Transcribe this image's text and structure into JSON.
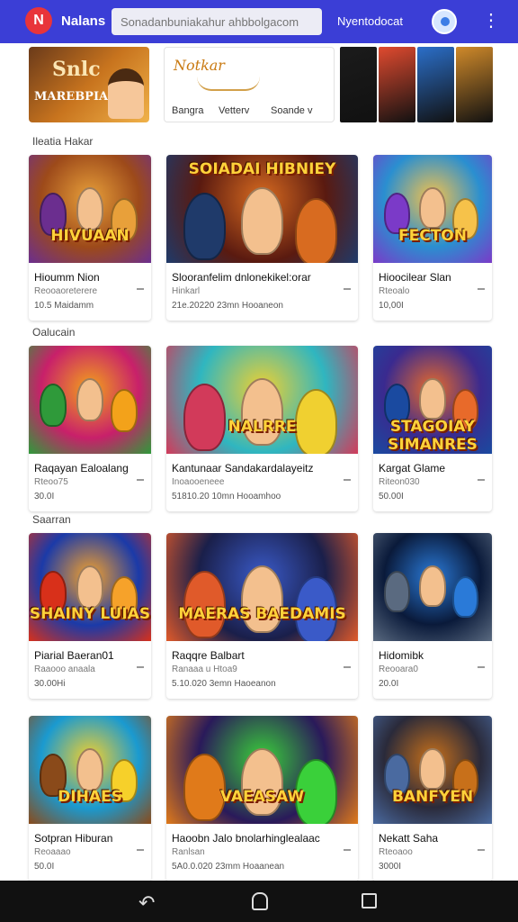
{
  "header": {
    "logo_letter": "N",
    "app_name": "Nalans",
    "search_placeholder": "Sonadanbuniakahur ahbbolgacom",
    "link": "Nyentodocat"
  },
  "banners": {
    "a_title": "Snlc",
    "a_subtitle": "MAREBPIAEE",
    "b_title": "Notkar",
    "b_filters": [
      "Bangra",
      "Vetterv",
      "Soande v"
    ],
    "c_colors": [
      "#1b1b1b",
      "#e04a2f",
      "#2b6fc9",
      "#d08a2a"
    ]
  },
  "sections": [
    {
      "label": "Ileatia Hakar",
      "cards": [
        {
          "name": "Hioumm Nion",
          "meta": "Reooaoreterere",
          "price": "10.5 Maidamm",
          "art": "HIVUAAN",
          "colors": [
            "#9d4a1a",
            "#e8a03a",
            "#6b2e8f"
          ]
        },
        {
          "name": "Slooranfelim dnlonekikel:orar",
          "meta": "Hinkarl",
          "price": "21e.20220   23mn   Hooaneon",
          "art": "SOIADAI HIBNIEY",
          "colors": [
            "#5a1a10",
            "#d86b20",
            "#1f3a6a"
          ]
        },
        {
          "name": "Hioocilear Slan",
          "meta": "Rteoalo",
          "price": "10,00I",
          "art": "FECTON",
          "colors": [
            "#2a8fd0",
            "#f6c24a",
            "#7b3ac8"
          ]
        }
      ]
    },
    {
      "label": "Oalucain",
      "cards": [
        {
          "name": "Raqayan Ealoalang",
          "meta": "Rteoo75",
          "price": "30.0I",
          "art": "",
          "colors": [
            "#c8206a",
            "#f3a21a",
            "#2f9a3a"
          ]
        },
        {
          "name": "Kantunaar Sandakardalayeitz",
          "meta": "Inoaooeneee",
          "price": "51810.20   10mn   Hooamhoo",
          "art": "NALRRE",
          "colors": [
            "#2fb6c0",
            "#f0d030",
            "#d23a5a"
          ]
        },
        {
          "name": "Kargat Glame",
          "meta": "Riteon030",
          "price": "50.00I",
          "art": "STAGOIAY SIMANRES",
          "colors": [
            "#3a2a8f",
            "#e86a2a",
            "#1a4aa0"
          ]
        }
      ]
    },
    {
      "label": "Saarran",
      "cards": [
        {
          "name": "Piarial Baeran01",
          "meta": "Raaooo anaala",
          "price": "30.00Hi",
          "art": "SHAINY LUIAS",
          "colors": [
            "#1b3aa8",
            "#f6a22a",
            "#d8301a"
          ]
        },
        {
          "name": "Raqqre Balbart",
          "meta": "Ranaaa   u Htoa9",
          "price": "5.10.020   3emn   Haoeanon",
          "art": "MAERAS BAEDAMIS",
          "colors": [
            "#1a1f4a",
            "#3a5ac8",
            "#e05a2a"
          ]
        },
        {
          "name": "Hidomibk",
          "meta": "Reooara0",
          "price": "20.0I",
          "art": "",
          "colors": [
            "#0a1a3a",
            "#2a7ad8",
            "#5a6a80"
          ]
        }
      ]
    },
    {
      "label": "",
      "cards": [
        {
          "name": "Sotpran Hiburan",
          "meta": "Reoaaao",
          "price": "50.0I",
          "art": "DIHAES",
          "colors": [
            "#1a9ad0",
            "#f6d02a",
            "#8a4a1a"
          ]
        },
        {
          "name": "Haoobn Jalo bnolarhinglealaac",
          "meta": "Ranlsan",
          "price": "5A0.0.020   23mm   Hoaanean",
          "art": "VAEASAW",
          "colors": [
            "#2a1a5a",
            "#3ad03a",
            "#e07a1a"
          ]
        },
        {
          "name": "Nekatt Saha",
          "meta": "Rteoaoo",
          "price": "3000I",
          "art": "BANFYEN",
          "colors": [
            "#2a2a3a",
            "#c8701a",
            "#4a6aa0"
          ]
        }
      ]
    }
  ],
  "navbar": {
    "back_glyph": "↶"
  }
}
